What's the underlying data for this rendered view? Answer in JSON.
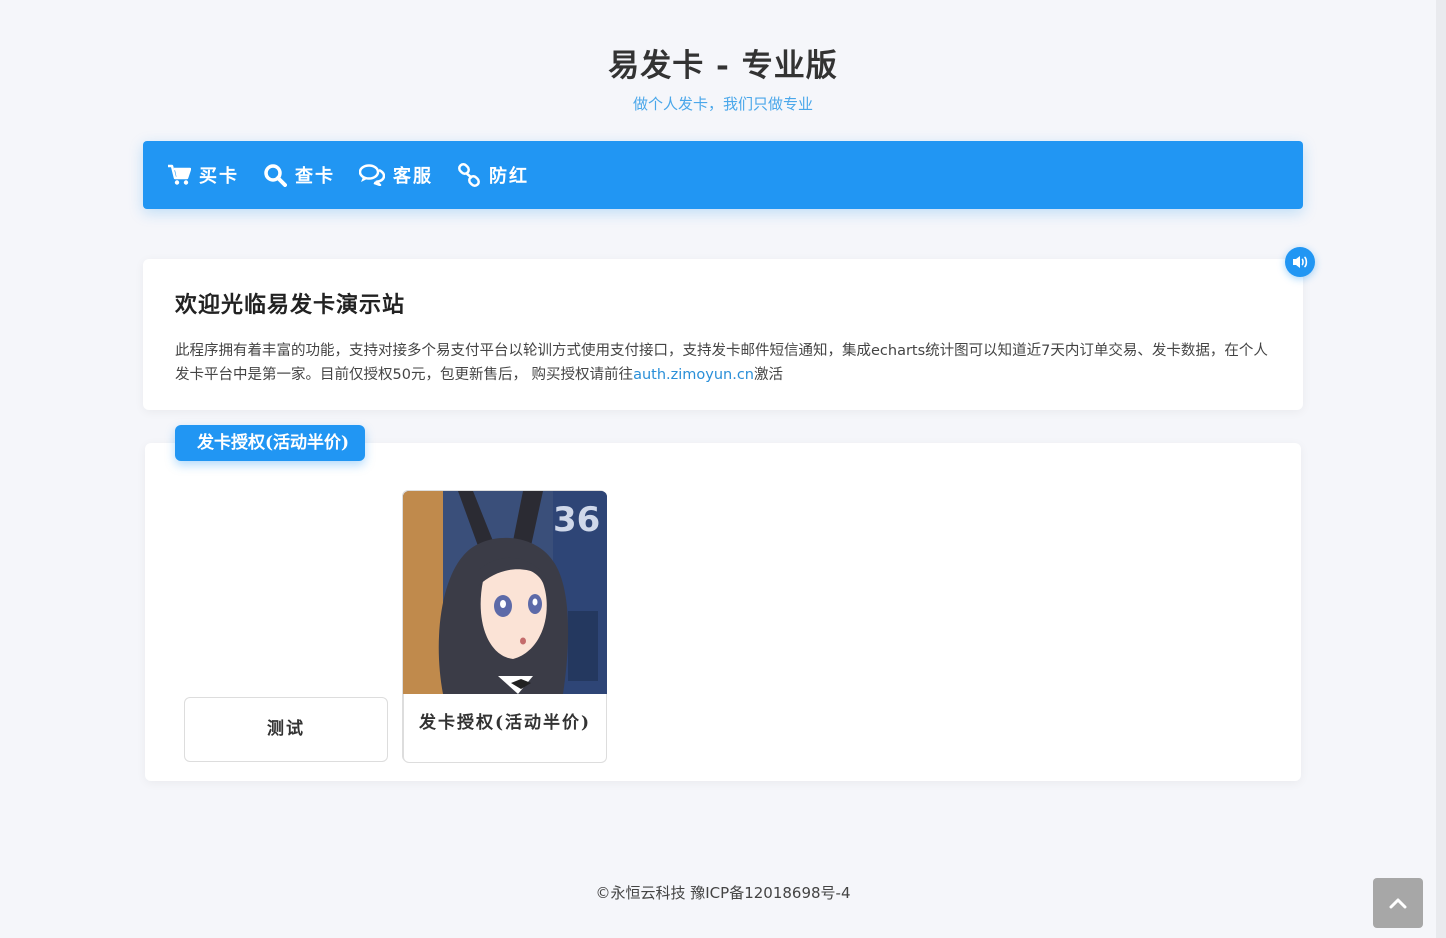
{
  "header": {
    "title": "易发卡 - 专业版",
    "subtitle": "做个人发卡，我们只做专业"
  },
  "nav": {
    "items": [
      {
        "label": "买卡",
        "icon": "cart-icon"
      },
      {
        "label": "查卡",
        "icon": "search-icon"
      },
      {
        "label": "客服",
        "icon": "chat-icon"
      },
      {
        "label": "防红",
        "icon": "link-icon"
      }
    ]
  },
  "notice": {
    "title": "欢迎光临易发卡演示站",
    "body_pre": "此程序拥有着丰富的功能，支持对接多个易支付平台以轮训方式使用支付接口，支持发卡邮件短信通知，集成echarts统计图可以知道近7天内订单交易、发卡数据，在个人发卡平台中是第一家。目前仅授权50元，包更新售后， 购买授权请前往",
    "link_text": "auth.zimoyun.cn",
    "body_post": "激活"
  },
  "category": {
    "tag_label": "发卡授权(活动半价)",
    "cards": [
      {
        "label": "测试"
      },
      {
        "label": "发卡授权(活动半价)"
      }
    ]
  },
  "footer": {
    "text": "©永恒云科技 豫ICP备12018698号-4"
  },
  "colors": {
    "accent": "#2196f3",
    "subtitle": "#4aa7ea",
    "background": "#f5f6fa"
  }
}
